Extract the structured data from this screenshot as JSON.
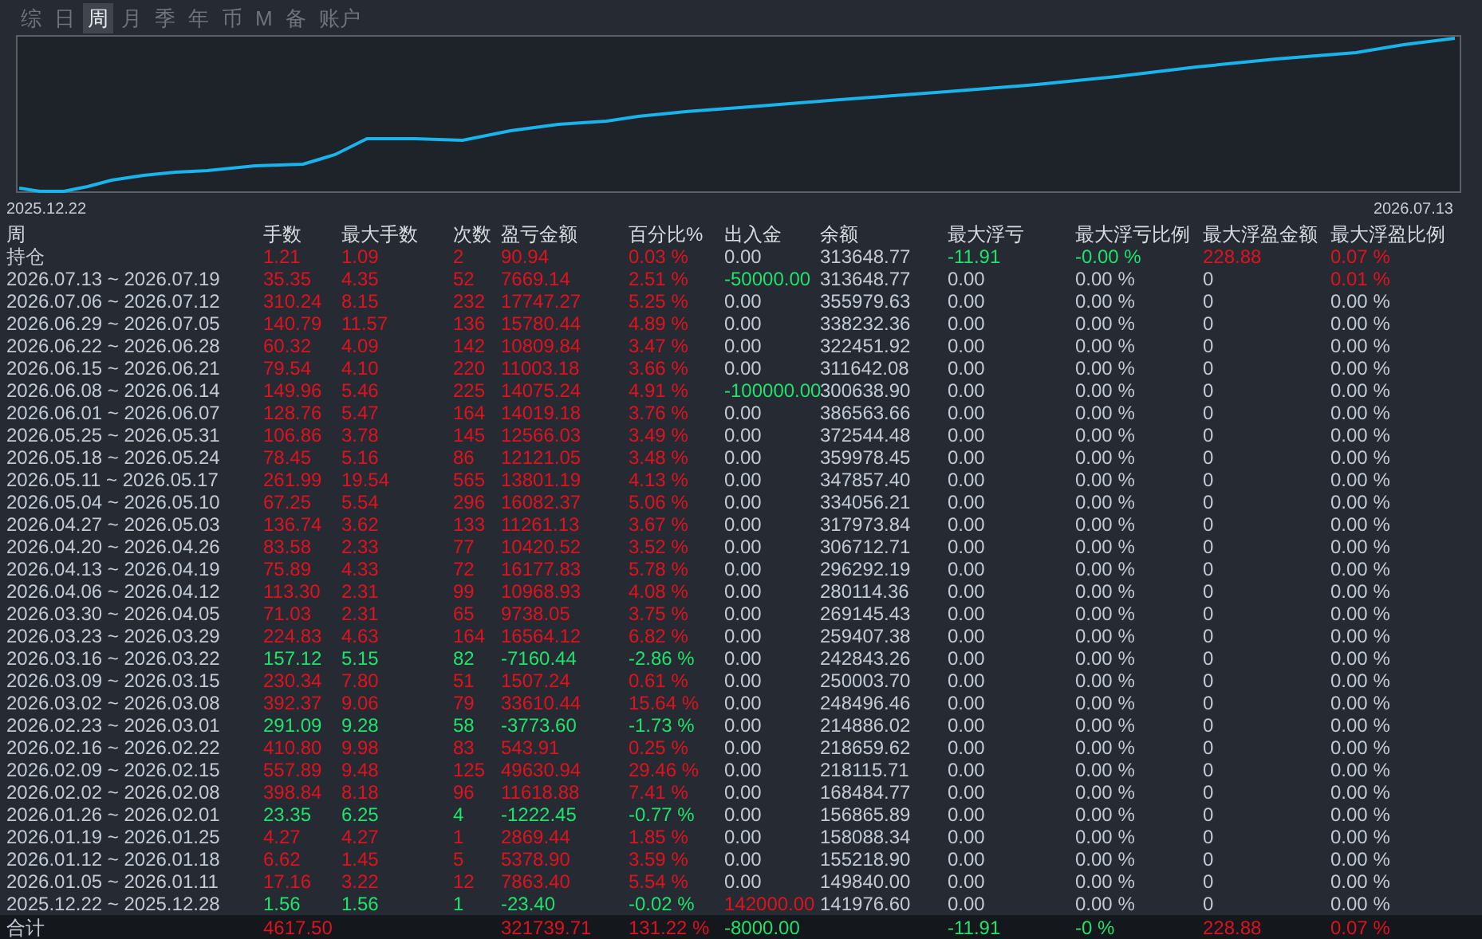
{
  "tabs": [
    {
      "label": "综",
      "selected": false
    },
    {
      "label": "日",
      "selected": false
    },
    {
      "label": "周",
      "selected": true
    },
    {
      "label": "月",
      "selected": false
    },
    {
      "label": "季",
      "selected": false
    },
    {
      "label": "年",
      "selected": false
    },
    {
      "label": "币",
      "selected": false
    },
    {
      "label": "M",
      "selected": false
    },
    {
      "label": "备",
      "selected": false
    },
    {
      "label": "账户",
      "selected": false
    }
  ],
  "equity_chart": {
    "start_label": "2025.12.22",
    "end_label": "2026.07.13"
  },
  "table": {
    "columns": [
      "周",
      "手数",
      "最大手数",
      "次数",
      "盈亏金额",
      "百分比%",
      "出入金",
      "余额",
      "最大浮亏",
      "最大浮亏比例",
      "最大浮盈金额",
      "最大浮盈比例"
    ],
    "rows": [
      [
        {
          "text": "持仓"
        },
        {
          "text": "1.21",
          "kind": "profit"
        },
        {
          "text": "1.09",
          "kind": "profit"
        },
        {
          "text": "2",
          "kind": "profit"
        },
        {
          "text": "90.94",
          "kind": "profit"
        },
        {
          "text": "0.03 %",
          "kind": "profit"
        },
        {
          "text": "0.00"
        },
        {
          "text": "313648.77"
        },
        {
          "text": "-11.91",
          "kind": "loss"
        },
        {
          "text": "-0.00 %",
          "kind": "loss"
        },
        {
          "text": "228.88",
          "kind": "profit"
        },
        {
          "text": "0.07 %",
          "kind": "profit"
        }
      ],
      [
        {
          "text": "2026.07.13 ~ 2026.07.19"
        },
        {
          "text": "35.35",
          "kind": "profit"
        },
        {
          "text": "4.35",
          "kind": "profit"
        },
        {
          "text": "52",
          "kind": "profit"
        },
        {
          "text": "7669.14",
          "kind": "profit"
        },
        {
          "text": "2.51 %",
          "kind": "profit"
        },
        {
          "text": "-50000.00",
          "kind": "loss"
        },
        {
          "text": "313648.77"
        },
        {
          "text": "0.00"
        },
        {
          "text": "0.00 %"
        },
        {
          "text": "0"
        },
        {
          "text": "0.01 %",
          "kind": "profit"
        }
      ],
      [
        {
          "text": "2026.07.06 ~ 2026.07.12"
        },
        {
          "text": "310.24",
          "kind": "profit"
        },
        {
          "text": "8.15",
          "kind": "profit"
        },
        {
          "text": "232",
          "kind": "profit"
        },
        {
          "text": "17747.27",
          "kind": "profit"
        },
        {
          "text": "5.25 %",
          "kind": "profit"
        },
        {
          "text": "0.00"
        },
        {
          "text": "355979.63"
        },
        {
          "text": "0.00"
        },
        {
          "text": "0.00 %"
        },
        {
          "text": "0"
        },
        {
          "text": "0.00 %"
        }
      ],
      [
        {
          "text": "2026.06.29 ~ 2026.07.05"
        },
        {
          "text": "140.79",
          "kind": "profit"
        },
        {
          "text": "11.57",
          "kind": "profit"
        },
        {
          "text": "136",
          "kind": "profit"
        },
        {
          "text": "15780.44",
          "kind": "profit"
        },
        {
          "text": "4.89 %",
          "kind": "profit"
        },
        {
          "text": "0.00"
        },
        {
          "text": "338232.36"
        },
        {
          "text": "0.00"
        },
        {
          "text": "0.00 %"
        },
        {
          "text": "0"
        },
        {
          "text": "0.00 %"
        }
      ],
      [
        {
          "text": "2026.06.22 ~ 2026.06.28"
        },
        {
          "text": "60.32",
          "kind": "profit"
        },
        {
          "text": "4.09",
          "kind": "profit"
        },
        {
          "text": "142",
          "kind": "profit"
        },
        {
          "text": "10809.84",
          "kind": "profit"
        },
        {
          "text": "3.47 %",
          "kind": "profit"
        },
        {
          "text": "0.00"
        },
        {
          "text": "322451.92"
        },
        {
          "text": "0.00"
        },
        {
          "text": "0.00 %"
        },
        {
          "text": "0"
        },
        {
          "text": "0.00 %"
        }
      ],
      [
        {
          "text": "2026.06.15 ~ 2026.06.21"
        },
        {
          "text": "79.54",
          "kind": "profit"
        },
        {
          "text": "4.10",
          "kind": "profit"
        },
        {
          "text": "220",
          "kind": "profit"
        },
        {
          "text": "11003.18",
          "kind": "profit"
        },
        {
          "text": "3.66 %",
          "kind": "profit"
        },
        {
          "text": "0.00"
        },
        {
          "text": "311642.08"
        },
        {
          "text": "0.00"
        },
        {
          "text": "0.00 %"
        },
        {
          "text": "0"
        },
        {
          "text": "0.00 %"
        }
      ],
      [
        {
          "text": "2026.06.08 ~ 2026.06.14"
        },
        {
          "text": "149.96",
          "kind": "profit"
        },
        {
          "text": "5.46",
          "kind": "profit"
        },
        {
          "text": "225",
          "kind": "profit"
        },
        {
          "text": "14075.24",
          "kind": "profit"
        },
        {
          "text": "4.91 %",
          "kind": "profit"
        },
        {
          "text": "-100000.00",
          "kind": "loss"
        },
        {
          "text": "300638.90"
        },
        {
          "text": "0.00"
        },
        {
          "text": "0.00 %"
        },
        {
          "text": "0"
        },
        {
          "text": "0.00 %"
        }
      ],
      [
        {
          "text": "2026.06.01 ~ 2026.06.07"
        },
        {
          "text": "128.76",
          "kind": "profit"
        },
        {
          "text": "5.47",
          "kind": "profit"
        },
        {
          "text": "164",
          "kind": "profit"
        },
        {
          "text": "14019.18",
          "kind": "profit"
        },
        {
          "text": "3.76 %",
          "kind": "profit"
        },
        {
          "text": "0.00"
        },
        {
          "text": "386563.66"
        },
        {
          "text": "0.00"
        },
        {
          "text": "0.00 %"
        },
        {
          "text": "0"
        },
        {
          "text": "0.00 %"
        }
      ],
      [
        {
          "text": "2026.05.25 ~ 2026.05.31"
        },
        {
          "text": "106.86",
          "kind": "profit"
        },
        {
          "text": "3.78",
          "kind": "profit"
        },
        {
          "text": "145",
          "kind": "profit"
        },
        {
          "text": "12566.03",
          "kind": "profit"
        },
        {
          "text": "3.49 %",
          "kind": "profit"
        },
        {
          "text": "0.00"
        },
        {
          "text": "372544.48"
        },
        {
          "text": "0.00"
        },
        {
          "text": "0.00 %"
        },
        {
          "text": "0"
        },
        {
          "text": "0.00 %"
        }
      ],
      [
        {
          "text": "2026.05.18 ~ 2026.05.24"
        },
        {
          "text": "78.45",
          "kind": "profit"
        },
        {
          "text": "5.16",
          "kind": "profit"
        },
        {
          "text": "86",
          "kind": "profit"
        },
        {
          "text": "12121.05",
          "kind": "profit"
        },
        {
          "text": "3.48 %",
          "kind": "profit"
        },
        {
          "text": "0.00"
        },
        {
          "text": "359978.45"
        },
        {
          "text": "0.00"
        },
        {
          "text": "0.00 %"
        },
        {
          "text": "0"
        },
        {
          "text": "0.00 %"
        }
      ],
      [
        {
          "text": "2026.05.11 ~ 2026.05.17"
        },
        {
          "text": "261.99",
          "kind": "profit"
        },
        {
          "text": "19.54",
          "kind": "profit"
        },
        {
          "text": "565",
          "kind": "profit"
        },
        {
          "text": "13801.19",
          "kind": "profit"
        },
        {
          "text": "4.13 %",
          "kind": "profit"
        },
        {
          "text": "0.00"
        },
        {
          "text": "347857.40"
        },
        {
          "text": "0.00"
        },
        {
          "text": "0.00 %"
        },
        {
          "text": "0"
        },
        {
          "text": "0.00 %"
        }
      ],
      [
        {
          "text": "2026.05.04 ~ 2026.05.10"
        },
        {
          "text": "67.25",
          "kind": "profit"
        },
        {
          "text": "5.54",
          "kind": "profit"
        },
        {
          "text": "296",
          "kind": "profit"
        },
        {
          "text": "16082.37",
          "kind": "profit"
        },
        {
          "text": "5.06 %",
          "kind": "profit"
        },
        {
          "text": "0.00"
        },
        {
          "text": "334056.21"
        },
        {
          "text": "0.00"
        },
        {
          "text": "0.00 %"
        },
        {
          "text": "0"
        },
        {
          "text": "0.00 %"
        }
      ],
      [
        {
          "text": "2026.04.27 ~ 2026.05.03"
        },
        {
          "text": "136.74",
          "kind": "profit"
        },
        {
          "text": "3.62",
          "kind": "profit"
        },
        {
          "text": "133",
          "kind": "profit"
        },
        {
          "text": "11261.13",
          "kind": "profit"
        },
        {
          "text": "3.67 %",
          "kind": "profit"
        },
        {
          "text": "0.00"
        },
        {
          "text": "317973.84"
        },
        {
          "text": "0.00"
        },
        {
          "text": "0.00 %"
        },
        {
          "text": "0"
        },
        {
          "text": "0.00 %"
        }
      ],
      [
        {
          "text": "2026.04.20 ~ 2026.04.26"
        },
        {
          "text": "83.58",
          "kind": "profit"
        },
        {
          "text": "2.33",
          "kind": "profit"
        },
        {
          "text": "77",
          "kind": "profit"
        },
        {
          "text": "10420.52",
          "kind": "profit"
        },
        {
          "text": "3.52 %",
          "kind": "profit"
        },
        {
          "text": "0.00"
        },
        {
          "text": "306712.71"
        },
        {
          "text": "0.00"
        },
        {
          "text": "0.00 %"
        },
        {
          "text": "0"
        },
        {
          "text": "0.00 %"
        }
      ],
      [
        {
          "text": "2026.04.13 ~ 2026.04.19"
        },
        {
          "text": "75.89",
          "kind": "profit"
        },
        {
          "text": "4.33",
          "kind": "profit"
        },
        {
          "text": "72",
          "kind": "profit"
        },
        {
          "text": "16177.83",
          "kind": "profit"
        },
        {
          "text": "5.78 %",
          "kind": "profit"
        },
        {
          "text": "0.00"
        },
        {
          "text": "296292.19"
        },
        {
          "text": "0.00"
        },
        {
          "text": "0.00 %"
        },
        {
          "text": "0"
        },
        {
          "text": "0.00 %"
        }
      ],
      [
        {
          "text": "2026.04.06 ~ 2026.04.12"
        },
        {
          "text": "113.30",
          "kind": "profit"
        },
        {
          "text": "2.31",
          "kind": "profit"
        },
        {
          "text": "99",
          "kind": "profit"
        },
        {
          "text": "10968.93",
          "kind": "profit"
        },
        {
          "text": "4.08 %",
          "kind": "profit"
        },
        {
          "text": "0.00"
        },
        {
          "text": "280114.36"
        },
        {
          "text": "0.00"
        },
        {
          "text": "0.00 %"
        },
        {
          "text": "0"
        },
        {
          "text": "0.00 %"
        }
      ],
      [
        {
          "text": "2026.03.30 ~ 2026.04.05"
        },
        {
          "text": "71.03",
          "kind": "profit"
        },
        {
          "text": "2.31",
          "kind": "profit"
        },
        {
          "text": "65",
          "kind": "profit"
        },
        {
          "text": "9738.05",
          "kind": "profit"
        },
        {
          "text": "3.75 %",
          "kind": "profit"
        },
        {
          "text": "0.00"
        },
        {
          "text": "269145.43"
        },
        {
          "text": "0.00"
        },
        {
          "text": "0.00 %"
        },
        {
          "text": "0"
        },
        {
          "text": "0.00 %"
        }
      ],
      [
        {
          "text": "2026.03.23 ~ 2026.03.29"
        },
        {
          "text": "224.83",
          "kind": "profit"
        },
        {
          "text": "4.63",
          "kind": "profit"
        },
        {
          "text": "164",
          "kind": "profit"
        },
        {
          "text": "16564.12",
          "kind": "profit"
        },
        {
          "text": "6.82 %",
          "kind": "profit"
        },
        {
          "text": "0.00"
        },
        {
          "text": "259407.38"
        },
        {
          "text": "0.00"
        },
        {
          "text": "0.00 %"
        },
        {
          "text": "0"
        },
        {
          "text": "0.00 %"
        }
      ],
      [
        {
          "text": "2026.03.16 ~ 2026.03.22"
        },
        {
          "text": "157.12",
          "kind": "loss"
        },
        {
          "text": "5.15",
          "kind": "loss"
        },
        {
          "text": "82",
          "kind": "loss"
        },
        {
          "text": "-7160.44",
          "kind": "loss"
        },
        {
          "text": "-2.86 %",
          "kind": "loss"
        },
        {
          "text": "0.00"
        },
        {
          "text": "242843.26"
        },
        {
          "text": "0.00"
        },
        {
          "text": "0.00 %"
        },
        {
          "text": "0"
        },
        {
          "text": "0.00 %"
        }
      ],
      [
        {
          "text": "2026.03.09 ~ 2026.03.15"
        },
        {
          "text": "230.34",
          "kind": "profit"
        },
        {
          "text": "7.80",
          "kind": "profit"
        },
        {
          "text": "51",
          "kind": "profit"
        },
        {
          "text": "1507.24",
          "kind": "profit"
        },
        {
          "text": "0.61 %",
          "kind": "profit"
        },
        {
          "text": "0.00"
        },
        {
          "text": "250003.70"
        },
        {
          "text": "0.00"
        },
        {
          "text": "0.00 %"
        },
        {
          "text": "0"
        },
        {
          "text": "0.00 %"
        }
      ],
      [
        {
          "text": "2026.03.02 ~ 2026.03.08"
        },
        {
          "text": "392.37",
          "kind": "profit"
        },
        {
          "text": "9.06",
          "kind": "profit"
        },
        {
          "text": "79",
          "kind": "profit"
        },
        {
          "text": "33610.44",
          "kind": "profit"
        },
        {
          "text": "15.64 %",
          "kind": "profit"
        },
        {
          "text": "0.00"
        },
        {
          "text": "248496.46"
        },
        {
          "text": "0.00"
        },
        {
          "text": "0.00 %"
        },
        {
          "text": "0"
        },
        {
          "text": "0.00 %"
        }
      ],
      [
        {
          "text": "2026.02.23 ~ 2026.03.01"
        },
        {
          "text": "291.09",
          "kind": "loss"
        },
        {
          "text": "9.28",
          "kind": "loss"
        },
        {
          "text": "58",
          "kind": "loss"
        },
        {
          "text": "-3773.60",
          "kind": "loss"
        },
        {
          "text": "-1.73 %",
          "kind": "loss"
        },
        {
          "text": "0.00"
        },
        {
          "text": "214886.02"
        },
        {
          "text": "0.00"
        },
        {
          "text": "0.00 %"
        },
        {
          "text": "0"
        },
        {
          "text": "0.00 %"
        }
      ],
      [
        {
          "text": "2026.02.16 ~ 2026.02.22"
        },
        {
          "text": "410.80",
          "kind": "profit"
        },
        {
          "text": "9.98",
          "kind": "profit"
        },
        {
          "text": "83",
          "kind": "profit"
        },
        {
          "text": "543.91",
          "kind": "profit"
        },
        {
          "text": "0.25 %",
          "kind": "profit"
        },
        {
          "text": "0.00"
        },
        {
          "text": "218659.62"
        },
        {
          "text": "0.00"
        },
        {
          "text": "0.00 %"
        },
        {
          "text": "0"
        },
        {
          "text": "0.00 %"
        }
      ],
      [
        {
          "text": "2026.02.09 ~ 2026.02.15"
        },
        {
          "text": "557.89",
          "kind": "profit"
        },
        {
          "text": "9.48",
          "kind": "profit"
        },
        {
          "text": "125",
          "kind": "profit"
        },
        {
          "text": "49630.94",
          "kind": "profit"
        },
        {
          "text": "29.46 %",
          "kind": "profit"
        },
        {
          "text": "0.00"
        },
        {
          "text": "218115.71"
        },
        {
          "text": "0.00"
        },
        {
          "text": "0.00 %"
        },
        {
          "text": "0"
        },
        {
          "text": "0.00 %"
        }
      ],
      [
        {
          "text": "2026.02.02 ~ 2026.02.08"
        },
        {
          "text": "398.84",
          "kind": "profit"
        },
        {
          "text": "8.18",
          "kind": "profit"
        },
        {
          "text": "96",
          "kind": "profit"
        },
        {
          "text": "11618.88",
          "kind": "profit"
        },
        {
          "text": "7.41 %",
          "kind": "profit"
        },
        {
          "text": "0.00"
        },
        {
          "text": "168484.77"
        },
        {
          "text": "0.00"
        },
        {
          "text": "0.00 %"
        },
        {
          "text": "0"
        },
        {
          "text": "0.00 %"
        }
      ],
      [
        {
          "text": "2026.01.26 ~ 2026.02.01"
        },
        {
          "text": "23.35",
          "kind": "loss"
        },
        {
          "text": "6.25",
          "kind": "loss"
        },
        {
          "text": "4",
          "kind": "loss"
        },
        {
          "text": "-1222.45",
          "kind": "loss"
        },
        {
          "text": "-0.77 %",
          "kind": "loss"
        },
        {
          "text": "0.00"
        },
        {
          "text": "156865.89"
        },
        {
          "text": "0.00"
        },
        {
          "text": "0.00 %"
        },
        {
          "text": "0"
        },
        {
          "text": "0.00 %"
        }
      ],
      [
        {
          "text": "2026.01.19 ~ 2026.01.25"
        },
        {
          "text": "4.27",
          "kind": "profit"
        },
        {
          "text": "4.27",
          "kind": "profit"
        },
        {
          "text": "1",
          "kind": "profit"
        },
        {
          "text": "2869.44",
          "kind": "profit"
        },
        {
          "text": "1.85 %",
          "kind": "profit"
        },
        {
          "text": "0.00"
        },
        {
          "text": "158088.34"
        },
        {
          "text": "0.00"
        },
        {
          "text": "0.00 %"
        },
        {
          "text": "0"
        },
        {
          "text": "0.00 %"
        }
      ],
      [
        {
          "text": "2026.01.12 ~ 2026.01.18"
        },
        {
          "text": "6.62",
          "kind": "profit"
        },
        {
          "text": "1.45",
          "kind": "profit"
        },
        {
          "text": "5",
          "kind": "profit"
        },
        {
          "text": "5378.90",
          "kind": "profit"
        },
        {
          "text": "3.59 %",
          "kind": "profit"
        },
        {
          "text": "0.00"
        },
        {
          "text": "155218.90"
        },
        {
          "text": "0.00"
        },
        {
          "text": "0.00 %"
        },
        {
          "text": "0"
        },
        {
          "text": "0.00 %"
        }
      ],
      [
        {
          "text": "2026.01.05 ~ 2026.01.11"
        },
        {
          "text": "17.16",
          "kind": "profit"
        },
        {
          "text": "3.22",
          "kind": "profit"
        },
        {
          "text": "12",
          "kind": "profit"
        },
        {
          "text": "7863.40",
          "kind": "profit"
        },
        {
          "text": "5.54 %",
          "kind": "profit"
        },
        {
          "text": "0.00"
        },
        {
          "text": "149840.00"
        },
        {
          "text": "0.00"
        },
        {
          "text": "0.00 %"
        },
        {
          "text": "0"
        },
        {
          "text": "0.00 %"
        }
      ],
      [
        {
          "text": "2025.12.22 ~ 2025.12.28"
        },
        {
          "text": "1.56",
          "kind": "loss"
        },
        {
          "text": "1.56",
          "kind": "loss"
        },
        {
          "text": "1",
          "kind": "loss"
        },
        {
          "text": "-23.40",
          "kind": "loss"
        },
        {
          "text": "-0.02 %",
          "kind": "loss"
        },
        {
          "text": "142000.00",
          "kind": "profit"
        },
        {
          "text": "141976.60"
        },
        {
          "text": "0.00"
        },
        {
          "text": "0.00 %"
        },
        {
          "text": "0"
        },
        {
          "text": "0.00 %"
        }
      ]
    ],
    "total": [
      {
        "text": "合计"
      },
      {
        "text": "4617.50",
        "kind": "profit"
      },
      {
        "kind": "blank"
      },
      {
        "kind": "blank"
      },
      {
        "text": "321739.71",
        "kind": "profit"
      },
      {
        "text": "131.22 %",
        "kind": "profit"
      },
      {
        "text": "-8000.00",
        "kind": "loss"
      },
      {
        "kind": "blank"
      },
      {
        "text": "-11.91",
        "kind": "loss"
      },
      {
        "text": "-0 %",
        "kind": "loss"
      },
      {
        "text": "228.88",
        "kind": "profit"
      },
      {
        "text": "0.07 %",
        "kind": "profit"
      }
    ]
  }
}
